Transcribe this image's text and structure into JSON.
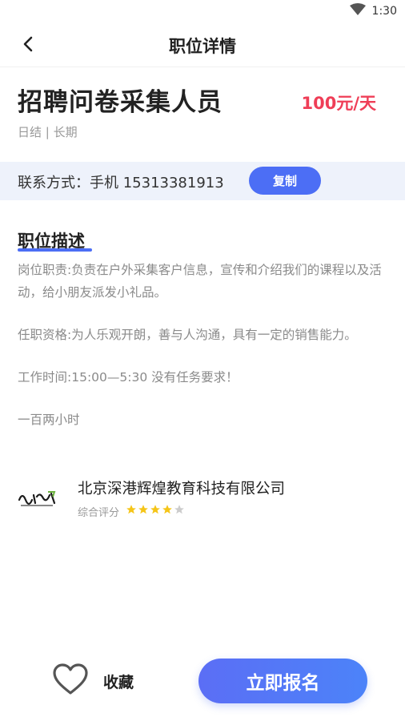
{
  "status_bar": {
    "time": "1:30",
    "wifi_icon": "wifi-icon"
  },
  "nav": {
    "title": "职位详情",
    "back_icon": "chevron-left-icon"
  },
  "job": {
    "title": "招聘问卷采集人员",
    "salary": "100元/天",
    "meta": "日结 | 长期"
  },
  "contact": {
    "text": "联系方式：手机 15313381913",
    "copy_label": "复制"
  },
  "description": {
    "title": "职位描述",
    "paragraphs": [
      "岗位职责:负责在户外采集客户信息，宣传和介绍我们的课程以及活动，给小朋友派发小礼品。",
      "任职资格:为人乐观开朗，善与人沟通，具有一定的销售能力。",
      "工作时间:15:00—5:30  没有任务要求！",
      "一百两小时"
    ]
  },
  "company": {
    "name": "北京深港辉煌教育科技有限公司",
    "rating_label": "综合评分",
    "rating": 4,
    "rating_max": 5
  },
  "bottom": {
    "favorite_label": "收藏",
    "apply_label": "立即报名"
  },
  "colors": {
    "accent": "#4c6ef5",
    "salary": "#ef3e57",
    "star_on": "#f5c518",
    "star_off": "#cccccc"
  }
}
